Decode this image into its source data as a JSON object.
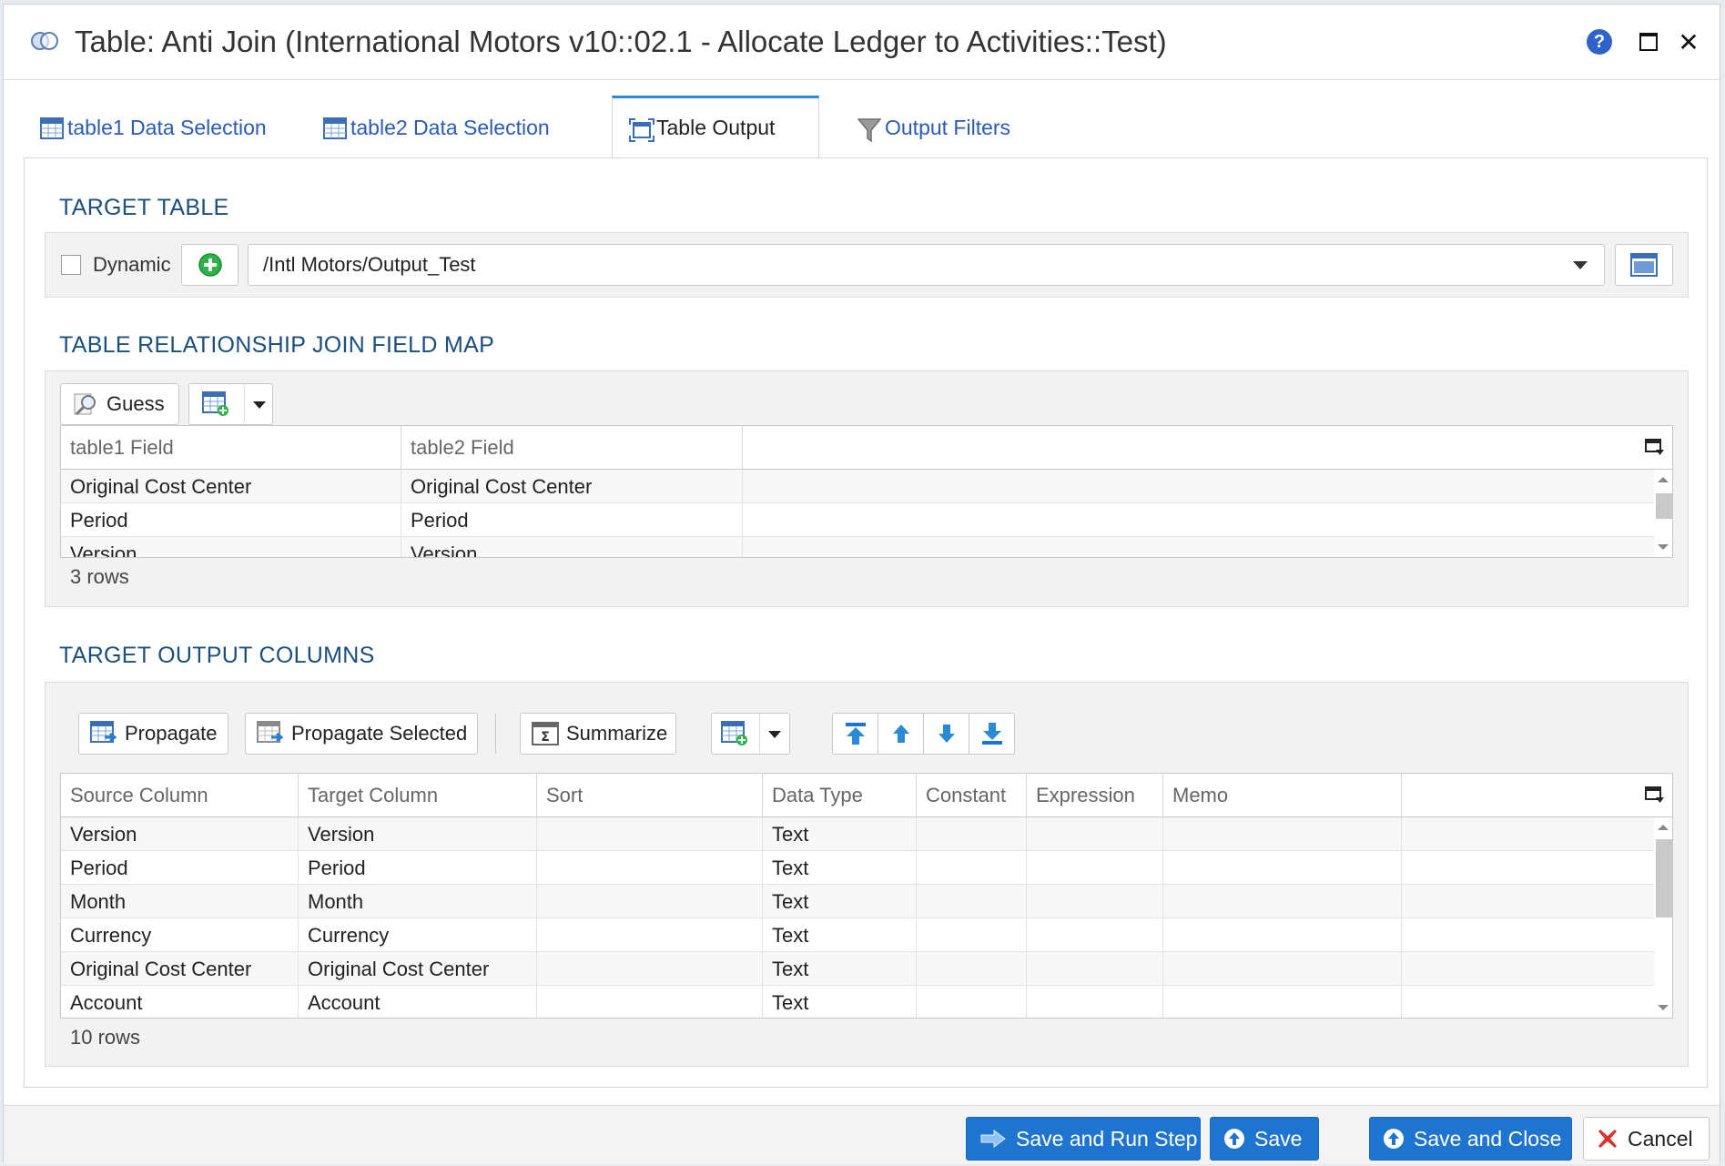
{
  "window": {
    "title": "Table: Anti Join (International Motors v10::02.1 - Allocate Ledger to Activities::Test)",
    "help_icon": "question-circle-icon",
    "help_glyph": "?",
    "maximize_icon": "maximize-icon",
    "close_icon": "close-icon",
    "close_glyph": "✕"
  },
  "tabs": [
    {
      "label": "table1 Data Selection",
      "icon": "table-grid-icon",
      "active": false
    },
    {
      "label": "table2 Data Selection",
      "icon": "table-grid-icon",
      "active": false
    },
    {
      "label": "Table Output",
      "icon": "table-output-icon",
      "active": true
    },
    {
      "label": "Output Filters",
      "icon": "funnel-icon",
      "active": false
    }
  ],
  "target_table": {
    "section_title": "TARGET TABLE",
    "dynamic_label": "Dynamic",
    "dynamic_checked": false,
    "add_icon": "add-circle-icon",
    "path_value": "/Intl Motors/Output_Test",
    "browse_icon": "table-browse-icon"
  },
  "join_map": {
    "section_title": "TABLE RELATIONSHIP JOIN FIELD MAP",
    "guess_label": "Guess",
    "columns": [
      "table1 Field",
      "table2 Field"
    ],
    "rows": [
      [
        "Original Cost Center",
        "Original Cost Center"
      ],
      [
        "Period",
        "Period"
      ],
      [
        "Version",
        "Version"
      ]
    ],
    "row_count": "3 rows"
  },
  "output_columns": {
    "section_title": "TARGET OUTPUT COLUMNS",
    "toolbar": {
      "propagate": "Propagate",
      "propagate_selected": "Propagate Selected",
      "summarize": "Summarize"
    },
    "columns": [
      "Source Column",
      "Target Column",
      "Sort",
      "Data Type",
      "Constant",
      "Expression",
      "Memo"
    ],
    "rows": [
      [
        "Version",
        "Version",
        "",
        "Text",
        "",
        "",
        ""
      ],
      [
        "Period",
        "Period",
        "",
        "Text",
        "",
        "",
        ""
      ],
      [
        "Month",
        "Month",
        "",
        "Text",
        "",
        "",
        ""
      ],
      [
        "Currency",
        "Currency",
        "",
        "Text",
        "",
        "",
        ""
      ],
      [
        "Original Cost Center",
        "Original Cost Center",
        "",
        "Text",
        "",
        "",
        ""
      ],
      [
        "Account",
        "Account",
        "",
        "Text",
        "",
        "",
        ""
      ]
    ],
    "row_count": "10 rows"
  },
  "footer": {
    "save_run": "Save and Run Step",
    "save": "Save",
    "save_close": "Save and Close",
    "cancel": "Cancel"
  },
  "colors": {
    "accent": "#1f74cf",
    "section_title": "#1b4f7e",
    "tab_link": "#2a5bb7",
    "cancel_x": "#d9342b"
  }
}
